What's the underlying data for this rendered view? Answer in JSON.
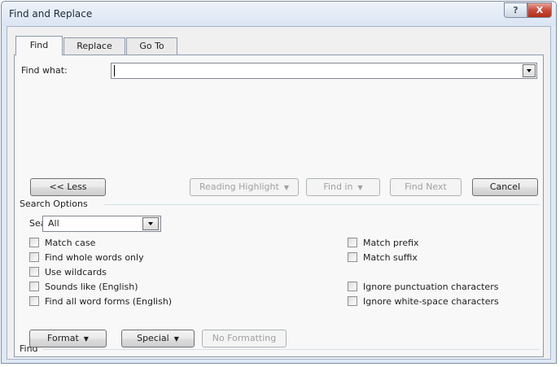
{
  "window": {
    "title": "Find and Replace",
    "help_label": "?",
    "close_label": "X"
  },
  "tabs": [
    {
      "label": "Find",
      "active": true
    },
    {
      "label": "Replace",
      "active": false
    },
    {
      "label": "Go To",
      "active": false
    }
  ],
  "find_what": {
    "label": "Find what:",
    "value": ""
  },
  "buttons": {
    "less": "<< Less",
    "reading_highlight": "Reading Highlight",
    "find_in": "Find in",
    "find_next": "Find Next",
    "cancel": "Cancel",
    "dropdown_glyph": "▼"
  },
  "search_options": {
    "heading": "Search Options",
    "search_label": "Search:",
    "search_value": "All",
    "left_checks": [
      {
        "label": "Match case",
        "checked": false
      },
      {
        "label": "Find whole words only",
        "checked": false
      },
      {
        "label": "Use wildcards",
        "checked": false
      },
      {
        "label": "Sounds like (English)",
        "checked": false
      },
      {
        "label": "Find all word forms (English)",
        "checked": false
      }
    ],
    "right_checks": [
      {
        "label": "Match prefix",
        "checked": false
      },
      {
        "label": "Match suffix",
        "checked": false
      },
      {
        "label": "Ignore punctuation characters",
        "checked": false
      },
      {
        "label": "Ignore white-space characters",
        "checked": false
      }
    ]
  },
  "find_section": {
    "heading": "Find",
    "format": "Format",
    "special": "Special",
    "no_formatting": "No Formatting"
  }
}
